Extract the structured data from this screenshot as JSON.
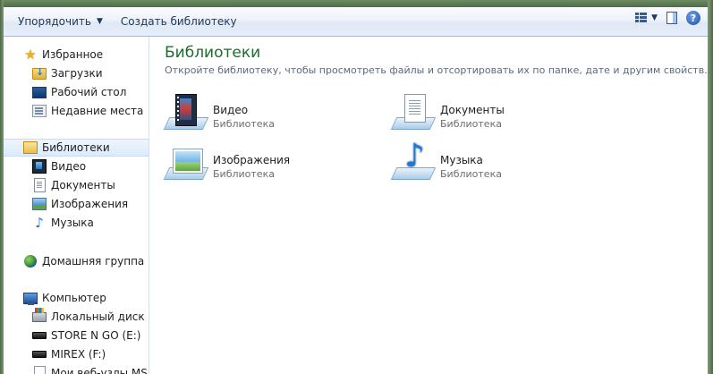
{
  "toolbar": {
    "organize_label": "Упорядочить",
    "new_library_label": "Создать библиотеку",
    "help_label": "?"
  },
  "nav": {
    "favorites": {
      "label": "Избранное",
      "items": [
        {
          "label": "Загрузки",
          "icon": "downloads-folder-icon"
        },
        {
          "label": "Рабочий стол",
          "icon": "desktop-icon"
        },
        {
          "label": "Недавние места",
          "icon": "recent-places-icon"
        }
      ]
    },
    "libraries": {
      "label": "Библиотеки",
      "items": [
        {
          "label": "Видео",
          "icon": "video-icon"
        },
        {
          "label": "Документы",
          "icon": "documents-icon"
        },
        {
          "label": "Изображения",
          "icon": "pictures-icon"
        },
        {
          "label": "Музыка",
          "icon": "music-icon"
        }
      ]
    },
    "homegroup": {
      "label": "Домашняя группа"
    },
    "computer": {
      "label": "Компьютер",
      "items": [
        {
          "label": "Локальный диск (C",
          "icon": "local-disk-icon"
        },
        {
          "label": "STORE N GO (E:)",
          "icon": "usb-drive-icon"
        },
        {
          "label": "MIREX (F:)",
          "icon": "usb-drive-icon"
        },
        {
          "label": "Мои веб-узлы MSN",
          "icon": "file-icon"
        }
      ]
    }
  },
  "main": {
    "title": "Библиотеки",
    "subtitle": "Откройте библиотеку, чтобы просмотреть файлы и отсортировать их по папке, дате и другим свойств...",
    "libraries": [
      {
        "name": "Видео",
        "type": "Библиотека",
        "icon": "video-library-icon"
      },
      {
        "name": "Документы",
        "type": "Библиотека",
        "icon": "documents-library-icon"
      },
      {
        "name": "Изображения",
        "type": "Библиотека",
        "icon": "pictures-library-icon"
      },
      {
        "name": "Музыка",
        "type": "Библиотека",
        "icon": "music-library-icon"
      }
    ]
  },
  "colors": {
    "title_green": "#1e6b2d",
    "toolbar_text": "#1e395b",
    "selection": "#dcebfc"
  }
}
